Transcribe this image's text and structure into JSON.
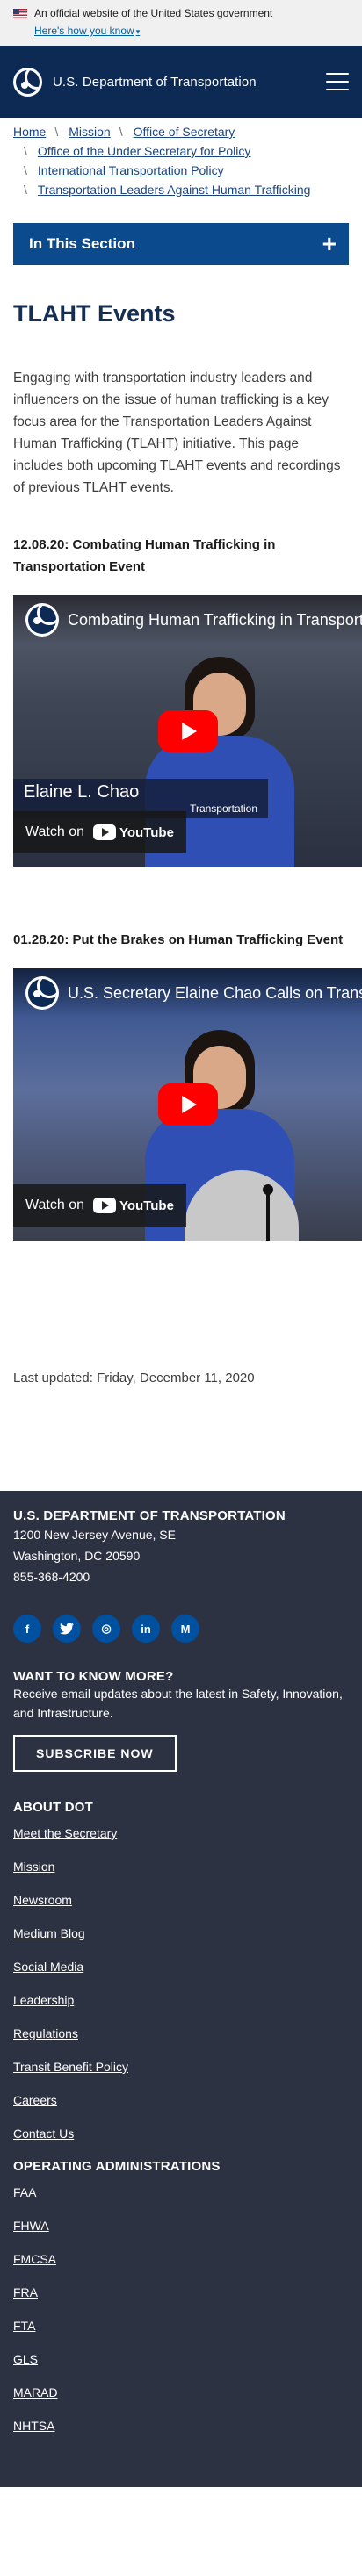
{
  "gov_banner": {
    "text": "An official website of the United States government",
    "how_link": "Here's how you know"
  },
  "header": {
    "brand": "U.S. Department of Transportation"
  },
  "breadcrumb": {
    "items": [
      "Home",
      "Mission",
      "Office of Secretary",
      "Office of the Under Secretary for Policy",
      "International Transportation Policy",
      "Transportation Leaders Against Human Trafficking"
    ]
  },
  "in_section": {
    "label": "In This Section",
    "icon": "plus"
  },
  "page": {
    "title": "TLAHT Events",
    "intro": "Engaging with transportation industry leaders and influencers on the issue of human trafficking is a key focus area for the Transportation Leaders Against Human Trafficking (TLAHT) initiative.  This page includes both upcoming TLAHT events and recordings of previous TLAHT events."
  },
  "events": [
    {
      "heading": "12.08.20: Combating Human Trafficking in Transportation Event",
      "video_title": "Combating Human Trafficking in Transport",
      "chyron_name": "Elaine L. Chao",
      "chyron_role": "Transportation",
      "watch": "Watch on",
      "yt": "YouTube"
    },
    {
      "heading": "01.28.20: Put the Brakes on Human Trafficking Event",
      "video_title": "U.S. Secretary Elaine Chao Calls on Transp",
      "watch": "Watch on",
      "yt": "YouTube"
    }
  ],
  "last_updated": "Last updated: Friday, December 11, 2020",
  "footer": {
    "org": "U.S. Department of Transportation",
    "address1": "1200 New Jersey Avenue, SE",
    "address2": "Washington, DC 20590",
    "phone": "855-368-4200",
    "socials": [
      {
        "icon": "facebook-icon",
        "glyph": "f"
      },
      {
        "icon": "twitter-icon",
        "glyph": "t"
      },
      {
        "icon": "instagram-icon",
        "glyph": "◎"
      },
      {
        "icon": "linkedin-icon",
        "glyph": "in"
      },
      {
        "icon": "medium-icon",
        "glyph": "M"
      }
    ],
    "more_head": "Want to know more?",
    "more_text": "Receive email updates about the latest in Safety, Innovation, and Infrastructure.",
    "subscribe": "Subscribe Now",
    "about_head": "About DOT",
    "about_links": [
      "Meet the Secretary",
      "Mission",
      "Newsroom",
      "Medium Blog",
      "Social Media",
      "Leadership",
      "Regulations",
      "Transit Benefit Policy",
      "Careers",
      "Contact Us"
    ],
    "op_head": "Operating Administrations",
    "op_links": [
      "FAA",
      "FHWA",
      "FMCSA",
      "FRA",
      "FTA",
      "GLS",
      "MARAD",
      "NHTSA"
    ]
  }
}
